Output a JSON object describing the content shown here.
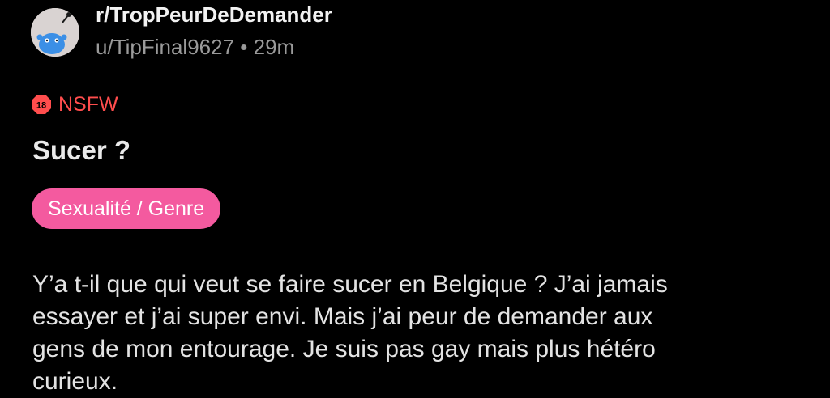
{
  "post": {
    "subreddit": "r/TropPeurDeDemander",
    "author": "u/TipFinal9627",
    "time": "29m",
    "separator": "•",
    "nsfw_label": "NSFW",
    "nsfw_badge_text": "18",
    "title": "Sucer ?",
    "flair": "Sexualité / Genre",
    "body": "Y’a t-il que qui veut se faire sucer en Belgique ? J’ai jamais\nessayer et j’ai super envi. Mais j’ai peur de demander aux\ngens de mon entourage. Je suis pas gay mais plus hétéro\ncurieux."
  },
  "icons": {
    "avatar": "snoo-avatar-icon",
    "nsfw": "nsfw-18-icon"
  },
  "colors": {
    "background": "#000000",
    "nsfw": "#ff4d4d",
    "flair": "#f45a9f",
    "meta": "#9a9a9a",
    "avatar_bg": "#d9d3d2",
    "avatar_snoo": "#3b8fe6"
  }
}
